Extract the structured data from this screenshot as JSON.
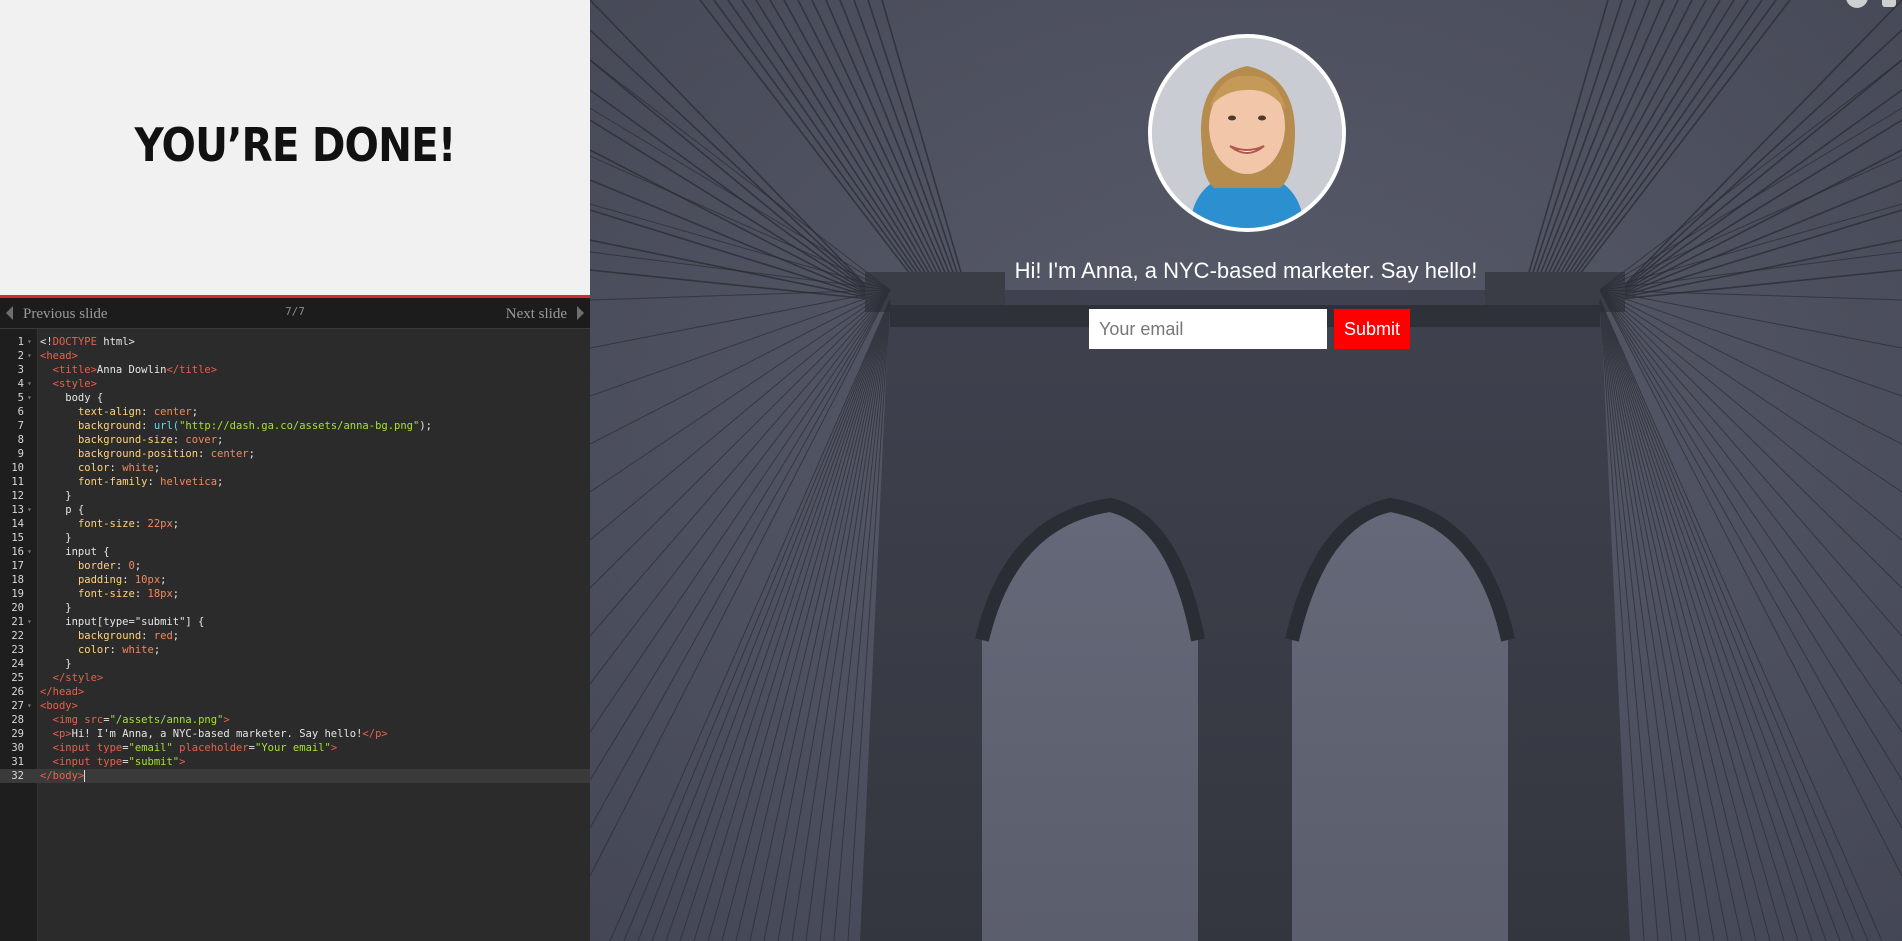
{
  "slide": {
    "heading": "YOU’RE DONE!"
  },
  "nav": {
    "prev_label": "Previous slide",
    "next_label": "Next slide",
    "slide_counter": "7/7"
  },
  "editor": {
    "lines": [
      [
        [
          "<!",
          "plain"
        ],
        [
          "DOCTYPE",
          "tag"
        ],
        [
          " html>",
          "plain"
        ]
      ],
      [
        [
          "<head>",
          "tag"
        ]
      ],
      [
        [
          "  ",
          "plain"
        ],
        [
          "<title>",
          "tag"
        ],
        [
          "Anna Dowlin",
          "plain"
        ],
        [
          "</title>",
          "tag"
        ]
      ],
      [
        [
          "  ",
          "plain"
        ],
        [
          "<style>",
          "tag"
        ]
      ],
      [
        [
          "    body {",
          "plain"
        ]
      ],
      [
        [
          "      ",
          "plain"
        ],
        [
          "text-align",
          "prop"
        ],
        [
          ": ",
          "plain"
        ],
        [
          "center",
          "val"
        ],
        [
          ";",
          "plain"
        ]
      ],
      [
        [
          "      ",
          "plain"
        ],
        [
          "background",
          "prop"
        ],
        [
          ": ",
          "plain"
        ],
        [
          "url(",
          "url"
        ],
        [
          "\"http://dash.ga.co/assets/anna-bg.png\"",
          "str"
        ],
        [
          ");",
          "plain"
        ]
      ],
      [
        [
          "      ",
          "plain"
        ],
        [
          "background-size",
          "prop"
        ],
        [
          ": ",
          "plain"
        ],
        [
          "cover",
          "val"
        ],
        [
          ";",
          "plain"
        ]
      ],
      [
        [
          "      ",
          "plain"
        ],
        [
          "background-position",
          "prop"
        ],
        [
          ": ",
          "plain"
        ],
        [
          "center",
          "val"
        ],
        [
          ";",
          "plain"
        ]
      ],
      [
        [
          "      ",
          "plain"
        ],
        [
          "color",
          "prop"
        ],
        [
          ": ",
          "plain"
        ],
        [
          "white",
          "val"
        ],
        [
          ";",
          "plain"
        ]
      ],
      [
        [
          "      ",
          "plain"
        ],
        [
          "font-family",
          "prop"
        ],
        [
          ": ",
          "plain"
        ],
        [
          "helvetica",
          "val"
        ],
        [
          ";",
          "plain"
        ]
      ],
      [
        [
          "    }",
          "plain"
        ]
      ],
      [
        [
          "    p {",
          "plain"
        ]
      ],
      [
        [
          "      ",
          "plain"
        ],
        [
          "font-size",
          "prop"
        ],
        [
          ": ",
          "plain"
        ],
        [
          "22px",
          "val"
        ],
        [
          ";",
          "plain"
        ]
      ],
      [
        [
          "    }",
          "plain"
        ]
      ],
      [
        [
          "    input {",
          "plain"
        ]
      ],
      [
        [
          "      ",
          "plain"
        ],
        [
          "border",
          "prop"
        ],
        [
          ": ",
          "plain"
        ],
        [
          "0",
          "val"
        ],
        [
          ";",
          "plain"
        ]
      ],
      [
        [
          "      ",
          "plain"
        ],
        [
          "padding",
          "prop"
        ],
        [
          ": ",
          "plain"
        ],
        [
          "10px",
          "val"
        ],
        [
          ";",
          "plain"
        ]
      ],
      [
        [
          "      ",
          "plain"
        ],
        [
          "font-size",
          "prop"
        ],
        [
          ": ",
          "plain"
        ],
        [
          "18px",
          "val"
        ],
        [
          ";",
          "plain"
        ]
      ],
      [
        [
          "    }",
          "plain"
        ]
      ],
      [
        [
          "    input[type=\"submit\"] {",
          "plain"
        ]
      ],
      [
        [
          "      ",
          "plain"
        ],
        [
          "background",
          "prop"
        ],
        [
          ": ",
          "plain"
        ],
        [
          "red",
          "val"
        ],
        [
          ";",
          "plain"
        ]
      ],
      [
        [
          "      ",
          "plain"
        ],
        [
          "color",
          "prop"
        ],
        [
          ": ",
          "plain"
        ],
        [
          "white",
          "val"
        ],
        [
          ";",
          "plain"
        ]
      ],
      [
        [
          "    }",
          "plain"
        ]
      ],
      [
        [
          "  ",
          "plain"
        ],
        [
          "</style>",
          "tag"
        ]
      ],
      [
        [
          "</head>",
          "tag"
        ]
      ],
      [
        [
          "<body>",
          "tag"
        ]
      ],
      [
        [
          "  ",
          "plain"
        ],
        [
          "<img ",
          "tag"
        ],
        [
          "src",
          "attr"
        ],
        [
          "=",
          "plain"
        ],
        [
          "\"/assets/anna.png\"",
          "str"
        ],
        [
          ">",
          "tag"
        ]
      ],
      [
        [
          "  ",
          "plain"
        ],
        [
          "<p>",
          "tag"
        ],
        [
          "Hi! I'm Anna, a NYC-based marketer. Say hello!",
          "plain"
        ],
        [
          "</p>",
          "tag"
        ]
      ],
      [
        [
          "  ",
          "plain"
        ],
        [
          "<input ",
          "tag"
        ],
        [
          "type",
          "attr"
        ],
        [
          "=",
          "plain"
        ],
        [
          "\"email\"",
          "str"
        ],
        [
          " placeholder",
          "attr"
        ],
        [
          "=",
          "plain"
        ],
        [
          "\"Your email\"",
          "str"
        ],
        [
          ">",
          "tag"
        ]
      ],
      [
        [
          "  ",
          "plain"
        ],
        [
          "<input ",
          "tag"
        ],
        [
          "type",
          "attr"
        ],
        [
          "=",
          "plain"
        ],
        [
          "\"submit\"",
          "str"
        ],
        [
          ">",
          "tag"
        ]
      ],
      [
        [
          "</body>",
          "tag"
        ]
      ]
    ],
    "fold_lines": [
      1,
      2,
      4,
      5,
      13,
      16,
      21,
      27
    ],
    "active_line": 32
  },
  "preview": {
    "tagline": "Hi! I'm Anna, a NYC-based marketer. Say hello!",
    "email_placeholder": "Your email",
    "submit_label": "Submit"
  },
  "colors": {
    "accent_red": "#ff0000",
    "slide_border": "#d8243a",
    "preview_bg": "#555866"
  },
  "icons": {
    "prev": "triangle-left-icon",
    "next": "triangle-right-icon"
  }
}
